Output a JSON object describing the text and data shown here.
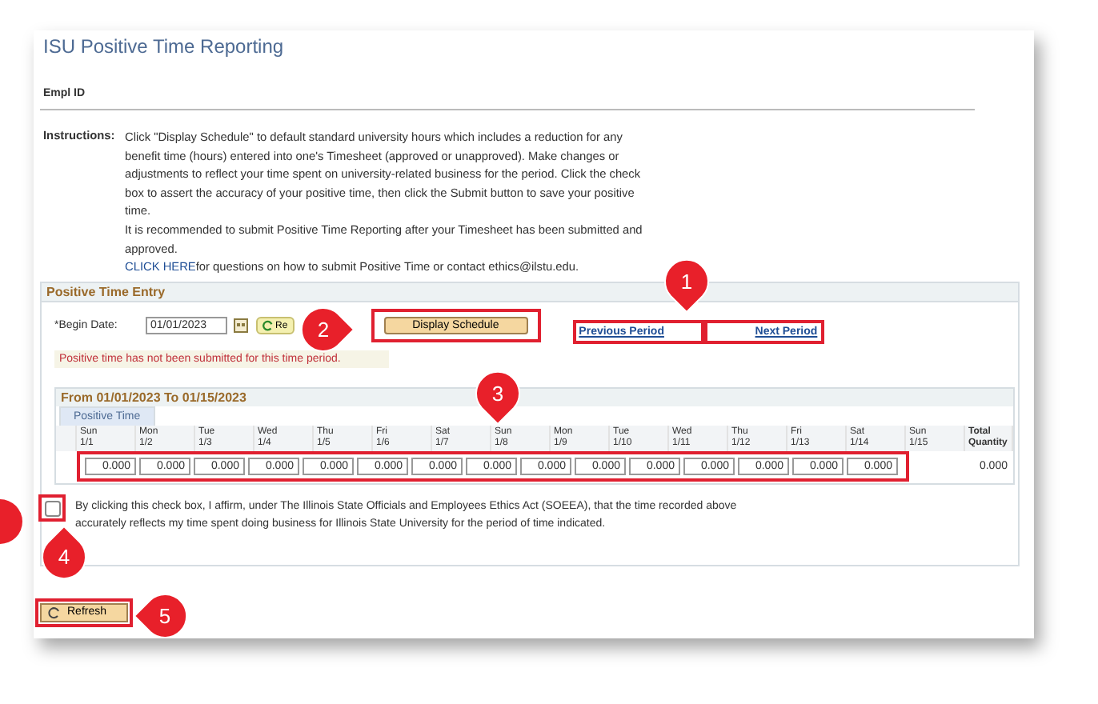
{
  "page": {
    "title": "ISU Positive Time Reporting"
  },
  "empl_id": {
    "label": "Empl ID"
  },
  "instructions": {
    "label": "Instructions:",
    "paragraphs": [
      "Click \"Display Schedule\" to default standard university hours which includes a reduction for any benefit time (hours) entered into one's Timesheet (approved or unapproved). Make changes or adjustments to reflect your time spent on university-related business for the period. Click the check box to assert the accuracy of your positive time, then click the Submit button to save your positive time.",
      "It is recommended to submit Positive Time Reporting after your Timesheet has been submitted and approved."
    ],
    "link": "CLICK HERE",
    "link_suffix": "for questions on how to submit Positive Time or contact ethics@ilstu.edu."
  },
  "entry": {
    "title": "Positive Time Entry",
    "begin_date": {
      "label": "*Begin Date:",
      "value": "01/01/2023"
    },
    "partial_button": "Re",
    "display_button": "Display Schedule",
    "previous_link": "Previous Period",
    "next_link": "Next Period",
    "message": "Positive time has not been submitted for this time period."
  },
  "grid": {
    "title": "From 01/01/2023 To 01/15/2023",
    "tab": {
      "label": "Positive Time",
      "selected": true
    },
    "total_header": "Total Quantity",
    "total": "0.000",
    "days": [
      {
        "day": "Sun",
        "date": "1/1",
        "value": "0.000"
      },
      {
        "day": "Mon",
        "date": "1/2",
        "value": "0.000"
      },
      {
        "day": "Tue",
        "date": "1/3",
        "value": "0.000"
      },
      {
        "day": "Wed",
        "date": "1/4",
        "value": "0.000"
      },
      {
        "day": "Thu",
        "date": "1/5",
        "value": "0.000"
      },
      {
        "day": "Fri",
        "date": "1/6",
        "value": "0.000"
      },
      {
        "day": "Sat",
        "date": "1/7",
        "value": "0.000"
      },
      {
        "day": "Sun",
        "date": "1/8",
        "value": "0.000"
      },
      {
        "day": "Mon",
        "date": "1/9",
        "value": "0.000"
      },
      {
        "day": "Tue",
        "date": "1/10",
        "value": "0.000"
      },
      {
        "day": "Wed",
        "date": "1/11",
        "value": "0.000"
      },
      {
        "day": "Thu",
        "date": "1/12",
        "value": "0.000"
      },
      {
        "day": "Fri",
        "date": "1/13",
        "value": "0.000"
      },
      {
        "day": "Sat",
        "date": "1/14",
        "value": "0.000"
      },
      {
        "day": "Sun",
        "date": "1/15",
        "value": "0.000"
      }
    ]
  },
  "affirm": {
    "checked": false,
    "text": "By clicking this check box, I affirm, under The Illinois State Officials and Employees Ethics Act (SOEEA), that the time recorded above accurately reflects my time spent doing business for Illinois State University for the period of time indicated."
  },
  "refresh_button": "Refresh",
  "callouts": [
    "1",
    "2",
    "3",
    "4",
    "5"
  ]
}
